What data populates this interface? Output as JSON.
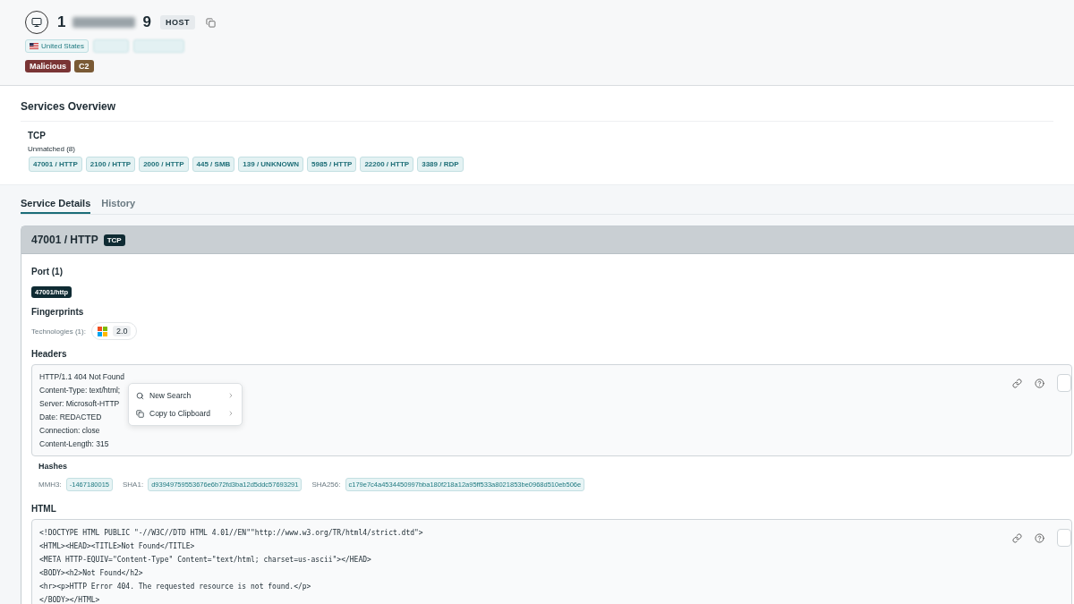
{
  "host": {
    "title_start": "1",
    "title_end": "9",
    "badge": "HOST",
    "location": "United States",
    "labels": [
      {
        "text": "Malicious",
        "color": "#7a3535"
      },
      {
        "text": "C2",
        "color": "#7a5a35"
      }
    ]
  },
  "services_overview": {
    "title": "Services Overview",
    "protocol": "TCP",
    "group": "Unmatched (8)",
    "services": [
      "47001 / HTTP",
      "2100 / HTTP",
      "2000 / HTTP",
      "445 / SMB",
      "139 / UNKNOWN",
      "5985 / HTTP",
      "22200 / HTTP",
      "3389 / RDP"
    ]
  },
  "tabs": [
    {
      "label": "Service Details",
      "selected": true
    },
    {
      "label": "History",
      "selected": false
    }
  ],
  "service": {
    "title": "47001 / HTTP",
    "transport": "TCP",
    "port_heading": "Port (1)",
    "port": "47001/http",
    "fingerprints_heading": "Fingerprints",
    "technologies_label": "Technologies (1):",
    "technology_version": "2.0",
    "headers_heading": "Headers",
    "headers": [
      "HTTP/1.1 404 Not Found",
      "Content-Type: text/html;",
      "Server: Microsoft-HTTP",
      "Date: REDACTED",
      "Connection: close",
      "Content-Length: 315"
    ],
    "context_menu": [
      "New Search",
      "Copy to Clipboard"
    ],
    "hashes_heading": "Hashes",
    "hashes": [
      {
        "label": "MMH3:",
        "value": "-1467180015"
      },
      {
        "label": "SHA1:",
        "value": "d93949759553676e6b72fd3ba12d5ddc57693291"
      },
      {
        "label": "SHA256:",
        "value": "c179e7c4a4534450997bba180f218a12a95ff533a8021853be0968d510eb506e"
      }
    ],
    "html_heading": "HTML",
    "html": [
      "<!DOCTYPE HTML PUBLIC \"-//W3C//DTD HTML 4.01//EN\"\"http://www.w3.org/TR/html4/strict.dtd\">",
      "<HTML><HEAD><TITLE>Not Found</TITLE>",
      "<META HTTP-EQUIV=\"Content-Type\" Content=\"text/html; charset=us-ascii\"></HEAD>",
      "<BODY><h2>Not Found</h2>",
      "<hr><p>HTTP Error 404. The requested resource is not found.</p>",
      "</BODY></HTML>"
    ]
  }
}
